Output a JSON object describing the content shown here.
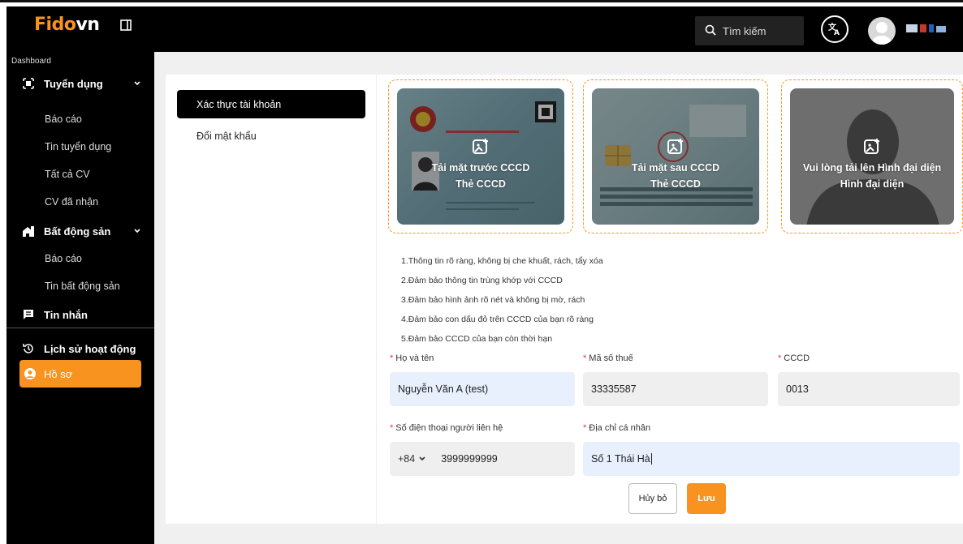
{
  "header": {
    "logo_main": "Fido",
    "logo_accent": "vn",
    "search_placeholder": "Tìm kiếm",
    "translate_icon": "translate-icon"
  },
  "sidebar": {
    "dashboard_label": "Dashboard",
    "groups": [
      {
        "label": "Tuyển dụng",
        "icon": "briefcase-icon",
        "items": [
          "Báo cáo",
          "Tin tuyển dụng",
          "Tất cả CV",
          "CV đã nhận"
        ]
      },
      {
        "label": "Bất động sản",
        "icon": "house-icon",
        "items": [
          "Báo cáo",
          "Tin bất động sản"
        ]
      }
    ],
    "messages_label": "Tin nhắn",
    "history_label": "Lịch sử hoạt động",
    "profile_label": "Hồ sơ"
  },
  "tabs": {
    "verify": "Xác thực tài khoản",
    "change_password": "Đổi mật khẩu"
  },
  "uploads": {
    "front": {
      "line1": "Tải mặt trước CCCD",
      "line2": "Thẻ CCCD"
    },
    "back": {
      "line1": "Tải mặt sau CCCD",
      "line2": "Thẻ CCCD"
    },
    "avatar": {
      "line1": "Vui lòng tải lên Hình đại diện",
      "line2": "Hình đại diện"
    }
  },
  "notes": [
    "1.Thông tin rõ ràng, không bị che khuất, rách, tẩy xóa",
    "2.Đảm bảo thông tin trùng khớp với CCCD",
    "3.Đảm bảo hình ảnh rõ nét và không bị mờ, rách",
    "4.Đảm bảo con dấu đỏ trên CCCD của bạn rõ ràng",
    "5.Đảm bảo CCCD của bạn còn thời hạn"
  ],
  "form": {
    "name_label": "Họ và tên",
    "name_value": "Nguyễn Văn A (test)",
    "tax_label": "Mã số thuế",
    "tax_value": "33335587",
    "cccd_label": "CCCD",
    "cccd_value": "0013",
    "phone_label": "Số điện thoại người liên hệ",
    "phone_prefix": "+84",
    "phone_value": "3999999999",
    "address_label": "Địa chỉ cá nhân",
    "address_value": "Số 1 Thái Hà",
    "required_mark": "*"
  },
  "actions": {
    "cancel": "Hủy bỏ",
    "save": "Lưu"
  },
  "colors": {
    "accent": "#f7931e",
    "sidebar_bg": "#000000",
    "field_blue": "#e8f0fe"
  }
}
